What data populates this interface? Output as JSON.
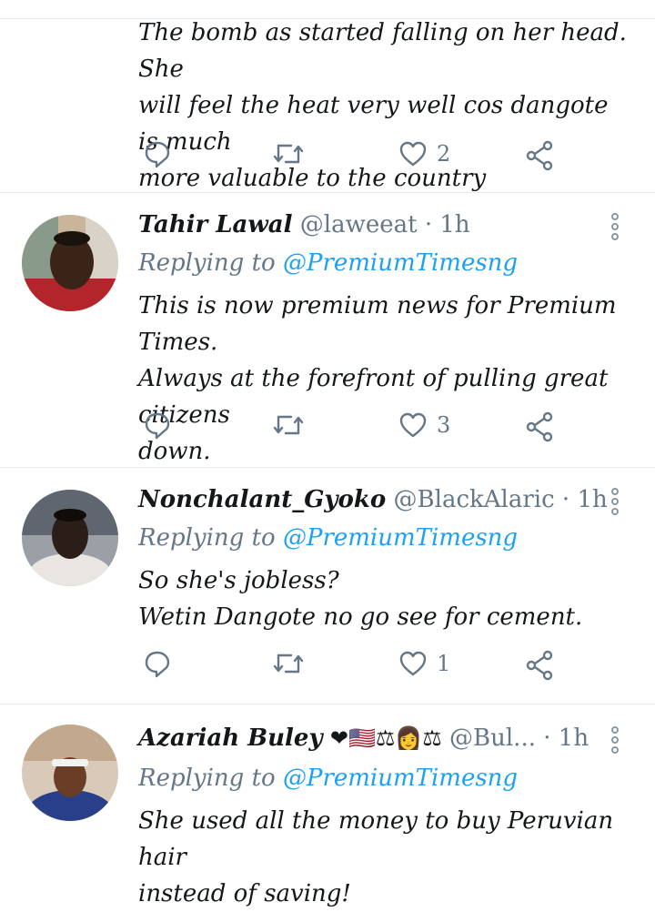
{
  "tweets": [
    {
      "body_lines": [
        "The bomb as started falling on her head. She",
        "will feel the heat very well cos dangote is much",
        "more valuable to the country"
      ],
      "reply_count": "",
      "retweet_count": "",
      "like_count": "2"
    },
    {
      "display_name": "Tahir Lawal",
      "handle": "@laweeat",
      "dot": "·",
      "time": "1h",
      "reply_prefix": "Replying to",
      "reply_to": "@PremiumTimesng",
      "body_lines": [
        "This is now premium news for Premium Times.",
        "Always at the forefront of pulling great citizens",
        "down."
      ],
      "like_count": "3"
    },
    {
      "display_name": "Nonchalant_Gyoko",
      "handle": "@BlackAlaric",
      "dot": "·",
      "time": "1h",
      "reply_prefix": "Replying to",
      "reply_to": "@PremiumTimesng",
      "body_lines": [
        "So she's jobless?",
        "Wetin Dangote no go see for cement."
      ],
      "like_count": "1"
    },
    {
      "display_name": "Azariah Buley",
      "name_emojis": "❤🇺🇸⚖👩⚖",
      "handle": "@Bul...",
      "dot": "·",
      "time": "1h",
      "reply_prefix": "Replying to",
      "reply_to": "@PremiumTimesng",
      "body_lines": [
        "She used all the money to buy Peruvian hair",
        "instead of saving!"
      ]
    }
  ],
  "icons": {
    "reply": "reply-icon",
    "retweet": "retweet-icon",
    "like": "heart-icon",
    "share": "share-icon",
    "more": "more-options-icon"
  },
  "colors": {
    "link": "#1da1f2",
    "secondary_text": "#657786",
    "icon": "#657786",
    "divider": "#e6ecf0"
  }
}
